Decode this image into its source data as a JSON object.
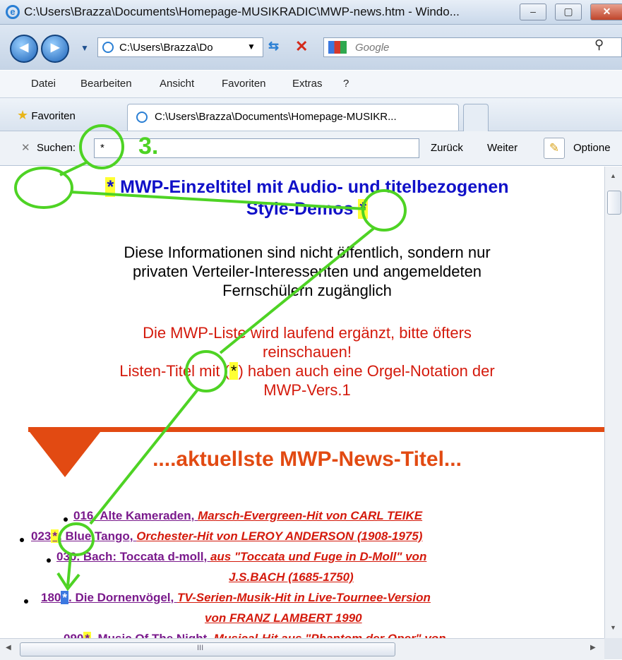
{
  "window": {
    "title": "C:\\Users\\Brazza\\Documents\\Homepage-MUSIKRADIC\\MWP-news.htm - Windo...",
    "minimize_glyph": "–",
    "maximize_glyph": "▢",
    "close_glyph": "✕"
  },
  "nav": {
    "back_glyph": "◀",
    "forward_glyph": "▶",
    "address": "C:\\Users\\Brazza\\Do",
    "search_placeholder": "Google"
  },
  "menu": [
    "Datei",
    "Bearbeiten",
    "Ansicht",
    "Favoriten",
    "Extras",
    "?"
  ],
  "favorites": {
    "label": "Favoriten",
    "tab_title": "C:\\Users\\Brazza\\Documents\\Homepage-MUSIKR..."
  },
  "find": {
    "label": "Suchen:",
    "value": "*",
    "prev": "Zurück",
    "next": "Weiter",
    "options": "Optione",
    "annotation": "3."
  },
  "content": {
    "heading_line1_prefix": "*",
    "heading_line1": "MWP-Einzeltitel mit Audio- und titelbezogenen",
    "heading_line2": "Style-Demos",
    "heading_line2_suffix": "*",
    "info_lines": [
      "Diese Informationen sind nicht öffentlich, sondern nur",
      "privaten Verteiler-Interessenten und angemeldeten",
      "Fernschülern zugänglich"
    ],
    "notice_line1": "Die MWP-Liste wird laufend ergänzt, bitte öfters",
    "notice_line2": "reinschauen!",
    "notice_line3_a": "Listen-Titel mit (",
    "notice_line3_star": "*",
    "notice_line3_b": ") haben auch eine Orgel-Notation der",
    "notice_line4": "MWP-Vers.1",
    "section_title": "....aktuellste MWP-News-Titel...",
    "news": [
      {
        "num": "016",
        "star": "",
        "title": ". Alte Kameraden, ",
        "desc": "Marsch-Evergreen-Hit von CARL TEIKE",
        "desc2": ""
      },
      {
        "num": "023",
        "star": "*",
        "title": ". Blue Tango, ",
        "desc": "Orchester-Hit von LEROY ANDERSON (1908-1975)",
        "desc2": ""
      },
      {
        "num": "030",
        "star": "",
        "title": ". Bach: Toccata d-moll, ",
        "desc": "aus \"Toccata und Fuge in D-Moll\" von",
        "desc2": "J.S.BACH (1685-1750)"
      },
      {
        "num": "180",
        "star": "*",
        "title": ". Die Dornenvögel, ",
        "desc": "TV-Serien-Musik-Hit in Live-Tournee-Version",
        "desc2": "von FRANZ LAMBERT 1990"
      },
      {
        "num": "090",
        "star": "*",
        "title": ". Music Of The Night, ",
        "desc": "Musical-Hit aus \"Phantom der Oper\" von",
        "desc2": ""
      }
    ]
  },
  "scroll": {
    "grip": "III"
  },
  "colors": {
    "annotation": "#4ed324",
    "highlight": "#ffff33",
    "selected": "#3b78e0",
    "heading": "#1010c8",
    "notice": "#d41a0c",
    "section": "#e24a12"
  }
}
